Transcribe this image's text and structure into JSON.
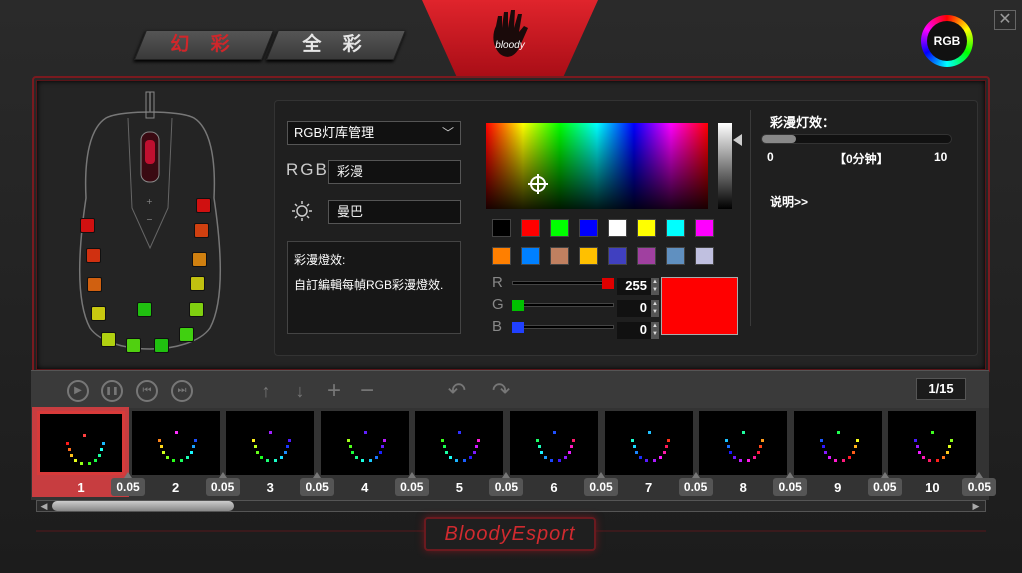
{
  "tabs": {
    "huancai": "幻 彩",
    "quancai": "全 彩"
  },
  "logo": {
    "text": "bloody"
  },
  "badge": {
    "rgb": "RGB"
  },
  "window": {
    "close": "✕"
  },
  "library": {
    "dropdown": "RGB灯库管理"
  },
  "rgb_label": "RGB",
  "mode": {
    "value": "彩漫"
  },
  "speed": {
    "value": "曼巴"
  },
  "description": {
    "title": "彩漫燈效:",
    "body": "自訂編輯每幀RGB彩漫燈效."
  },
  "channels": [
    {
      "label": "R",
      "value": "255",
      "fill": 1.0,
      "color": "#e00000"
    },
    {
      "label": "G",
      "value": "0",
      "fill": 0.0,
      "color": "#00c000"
    },
    {
      "label": "B",
      "value": "0",
      "fill": 0.0,
      "color": "#2040ff"
    }
  ],
  "preview_color": "#ff0000",
  "swatches_row1": [
    "#000000",
    "#ff0000",
    "#00ff00",
    "#0000ff",
    "#ffffff",
    "#ffff00",
    "#00ffff",
    "#ff00ff"
  ],
  "swatches_row2": [
    "#ff7f00",
    "#0080ff",
    "#c08060",
    "#ffc000",
    "#4040c0",
    "#a040a0",
    "#6090c0",
    "#c0c0e0"
  ],
  "effect": {
    "title": "彩漫灯效：",
    "min": "0",
    "unit": "【0分钟】",
    "max": "10",
    "help": "说明>>"
  },
  "toolbar": {
    "play": "▶",
    "pause": "❚❚",
    "prev": "⏮",
    "next": "⏭",
    "up": "↑",
    "down": "↓",
    "add": "+",
    "remove": "−",
    "undo": "↶",
    "redo": "↷",
    "page": "1/15"
  },
  "frames": [
    {
      "label": "1",
      "duration": "0.05",
      "top": "#ff4040"
    },
    {
      "label": "2",
      "duration": "0.05",
      "top": "#ff30ff"
    },
    {
      "label": "3",
      "duration": "0.05",
      "top": "#a020ff"
    },
    {
      "label": "4",
      "duration": "0.05",
      "top": "#6020ff"
    },
    {
      "label": "5",
      "duration": "0.05",
      "top": "#3030ff"
    },
    {
      "label": "6",
      "duration": "0.05",
      "top": "#2050ff"
    },
    {
      "label": "7",
      "duration": "0.05",
      "top": "#20c0ff"
    },
    {
      "label": "8",
      "duration": "0.05",
      "top": "#20ffa0"
    },
    {
      "label": "9",
      "duration": "0.05",
      "top": "#20ff50"
    },
    {
      "label": "10",
      "duration": "0.05",
      "top": "#40ff20"
    }
  ],
  "footer": {
    "brand": "BloodyEsport"
  }
}
